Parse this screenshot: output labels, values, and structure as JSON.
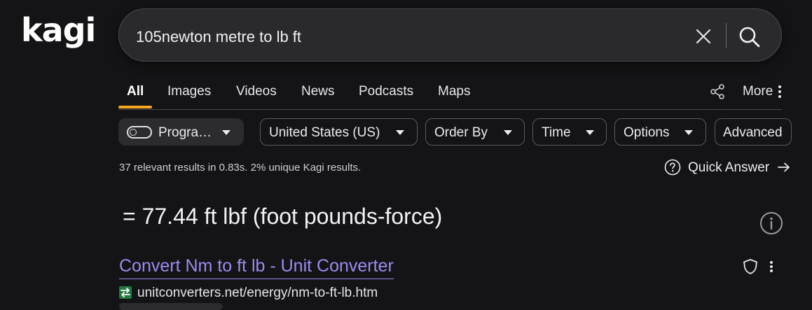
{
  "logo": {
    "text": "kagi"
  },
  "search": {
    "value": "105newton metre to lb ft"
  },
  "tabs": [
    {
      "label": "All",
      "active": true
    },
    {
      "label": "Images"
    },
    {
      "label": "Videos"
    },
    {
      "label": "News"
    },
    {
      "label": "Podcasts"
    },
    {
      "label": "Maps"
    }
  ],
  "more_label": "More",
  "filters": [
    {
      "label": "Progra…"
    },
    {
      "label": "United States (US)"
    },
    {
      "label": "Order By"
    },
    {
      "label": "Time"
    },
    {
      "label": "Options"
    },
    {
      "label": "Advanced"
    }
  ],
  "stats": "37 relevant results in 0.83s. 2% unique Kagi results.",
  "quick_answer": {
    "label": "Quick Answer"
  },
  "answer": "= 77.44 ft lbf (foot pounds-force)",
  "result": {
    "title": "Convert Nm to ft lb - Unit Converter",
    "url": "unitconverters.net/energy/nm-to-ft-lb.htm"
  },
  "colors": {
    "accent": "#f5a623",
    "link": "#9b8cf0",
    "background": "#141416"
  },
  "icons": [
    "clear-icon",
    "search-icon",
    "share-icon",
    "vertical-dots-icon",
    "chevron-down-icon",
    "help-circle-icon",
    "arrow-right-icon",
    "info-icon",
    "shield-icon",
    "favicon-icon"
  ]
}
